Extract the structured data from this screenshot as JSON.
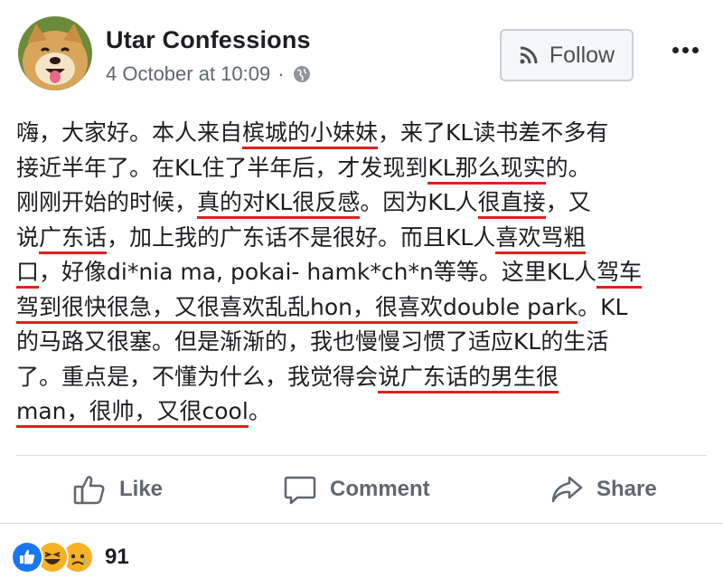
{
  "post": {
    "page_name": "Utar Confessions",
    "timestamp": "4 October at 10:09",
    "separator": "·",
    "privacy_icon": "globe-icon",
    "follow_label": "Follow",
    "more_icon": "more-icon",
    "lines": [
      [
        {
          "t": "嗨，大家好。本人来自"
        },
        {
          "t": "槟城的小妹妹",
          "u": true
        },
        {
          "t": "，来了KL读书差不多有"
        }
      ],
      [
        {
          "t": "接近半年了。在KL住了半年后，才发现到"
        },
        {
          "t": "KL那么现实",
          "u": true
        },
        {
          "t": "的。"
        }
      ],
      [
        {
          "t": "刚刚开始的时候，"
        },
        {
          "t": "真的对KL很反感",
          "u": true
        },
        {
          "t": "。因为KL人"
        },
        {
          "t": "很直接",
          "u": true
        },
        {
          "t": "，又"
        }
      ],
      [
        {
          "t": "说"
        },
        {
          "t": "广东话",
          "u": true
        },
        {
          "t": "，加上我的广东话不是很好。而且KL人"
        },
        {
          "t": "喜欢骂粗",
          "u": true
        }
      ],
      [
        {
          "t": "口",
          "u": true
        },
        {
          "t": "，好像di*nia ma, pokai- hamk*ch*n等等。这里KL人"
        },
        {
          "t": "驾车",
          "u": true
        }
      ],
      [
        {
          "t": "驾到很快很急，又很喜欢乱乱hon，很喜欢double park",
          "u": true
        },
        {
          "t": "。KL"
        }
      ],
      [
        {
          "t": "的马路又很塞。但是渐渐的，我也慢慢习惯了适应KL的生活"
        }
      ],
      [
        {
          "t": "了。重点是，不懂为什么，我觉得会"
        },
        {
          "t": "说广东话的男生很",
          "u": true
        }
      ],
      [
        {
          "t": "man，很帅，又很cool",
          "u": true
        },
        {
          "t": "。"
        }
      ]
    ]
  },
  "actions": {
    "like_label": "Like",
    "comment_label": "Comment",
    "share_label": "Share"
  },
  "reactions": {
    "icons": [
      "like-reaction-icon",
      "haha-reaction-icon",
      "sad-reaction-icon"
    ],
    "count": "91",
    "colors": {
      "like": "#1877f2",
      "haha": "#f7b125",
      "sad": "#f7b125"
    }
  },
  "colors": {
    "underline": "#e02020",
    "text": "#1c1e21",
    "muted": "#606770"
  }
}
